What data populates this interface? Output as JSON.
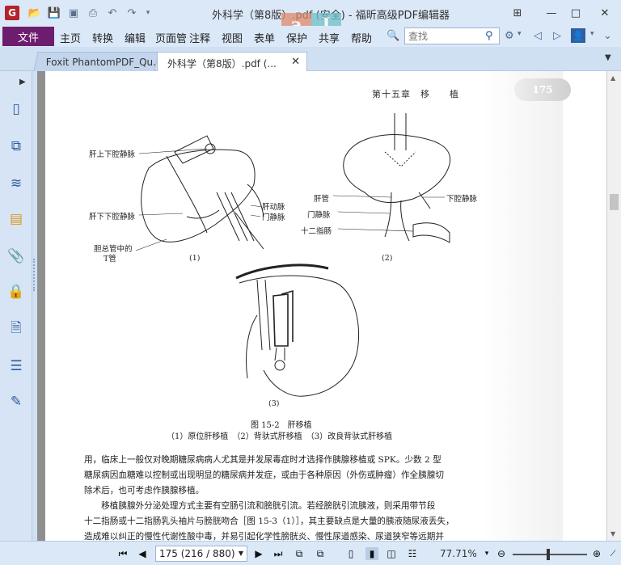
{
  "window": {
    "title": "外科学（第8版）.pdf (安全) - 福昕高级PDF编辑器",
    "watermark": [
      "a",
      "I"
    ]
  },
  "menu": {
    "file": "文件",
    "items": [
      "主页",
      "转换",
      "编辑",
      "页面管",
      "注释",
      "视图",
      "表单",
      "保护",
      "共享",
      "帮助"
    ],
    "search_placeholder": "查找"
  },
  "tabs": [
    {
      "label": "Foxit PhantomPDF_Qu..."
    },
    {
      "label": "外科学（第8版）.pdf (..."
    }
  ],
  "page": {
    "header": "第十五章　移　　植",
    "number": "175",
    "figure": {
      "labels": {
        "gan_shang": "肝上下腔静脉",
        "gan_xia": "肝下下腔静脉",
        "dan_zong": "胆总管中的",
        "t_guan": "T管",
        "gan_dong": "肝动脉",
        "men_jing": "门静脉",
        "sub1": "(1)",
        "gan_guan": "肝管",
        "xia_qiang": "下腔静脉",
        "men_jing2": "门静脉",
        "shi_er": "十二指肠",
        "sub2": "(2)",
        "sub3": "(3)"
      },
      "caption": "图 15-2　肝移植",
      "subcaption": "（1）原位肝移植　（2）背驮式肝移植　（3）改良背驮式肝移植"
    },
    "paragraphs": [
      "用，临床上一般仅对晚期糖尿病病人尤其是并发尿毒症时才选择作胰腺移植或 SPK。少数 2 型",
      "糖尿病因血糖难以控制或出现明显的糖尿病并发症，或由于各种原因（外伤或肿瘤）作全胰腺切",
      "除术后，也可考虑作胰腺移植。",
      "　　移植胰腺外分泌处理方式主要有空肠引流和膀胱引流。若经膀胱引流胰液，则采用带节段",
      "十二指肠或十二指肠乳头袖片与膀胱吻合［图 15-3（1）］，其主要缺点是大量的胰液随尿液丢失，",
      "造成难以纠正的慢性代谢性酸中毒，并易引起化学性膀胱炎、慢性尿道感染、尿道狭窄等远期并"
    ]
  },
  "status": {
    "page_field": "175 (216 / 880)",
    "zoom": "77.71%"
  }
}
